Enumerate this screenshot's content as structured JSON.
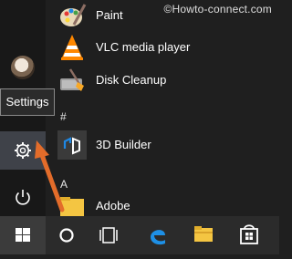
{
  "watermark": "©Howto-connect.com",
  "tooltip": "Settings",
  "section_letters": {
    "hash": "#",
    "a": "A"
  },
  "apps": [
    {
      "label": "Paint",
      "icon": "paint-icon"
    },
    {
      "label": "VLC media player",
      "icon": "vlc-icon"
    },
    {
      "label": "Disk Cleanup",
      "icon": "disk-cleanup-icon"
    },
    {
      "label": "3D Builder",
      "icon": "3d-builder-icon"
    },
    {
      "label": "Adobe",
      "icon": "folder-icon"
    }
  ],
  "taskbar_icons": [
    "windows-icon",
    "cortana-circle-icon",
    "task-view-icon",
    "edge-icon",
    "file-explorer-icon",
    "store-icon"
  ],
  "colors": {
    "accent_arrow": "#e36c2a",
    "settings_bg": "#3f4249",
    "tile_blue": "#0078d7"
  }
}
